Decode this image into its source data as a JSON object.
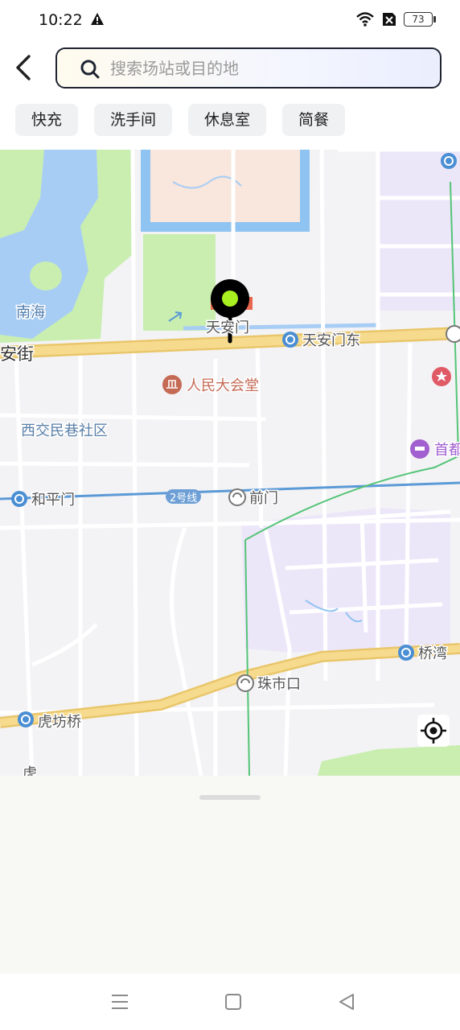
{
  "status_bar": {
    "time": "10:22",
    "battery": "73",
    "icons": [
      "warning-icon",
      "wifi-icon",
      "no-sim-icon",
      "battery-icon"
    ]
  },
  "header": {
    "back_icon": "chevron-left-icon",
    "search": {
      "placeholder": "搜索场站或目的地",
      "value": ""
    }
  },
  "filters": {
    "chips": [
      "快充",
      "洗手间",
      "休息室",
      "简餐"
    ]
  },
  "map": {
    "labels": {
      "nanhai": "南海",
      "an_jie": "安街",
      "tiananmen": "天安门",
      "tiananmen_east": "天安门东",
      "great_hall": "人民大会堂",
      "xijiao": "西交民巷社区",
      "heping_men": "和平门",
      "line2": "2号线",
      "qianmen": "前门",
      "shoudu": "首都",
      "qiaowan": "桥湾",
      "zhushikou": "珠市口",
      "hufangqiao": "虎坊桥",
      "hu": "虎"
    },
    "colors": {
      "water": "#a8cdf5",
      "park": "#c9eeb0",
      "palace": "#f9e6dc",
      "road_major": "#f6db8f",
      "purple_area": "#ece6f9",
      "subway": "#5b9ad6",
      "marker": "#000000",
      "marker_dot": "#a8f020"
    },
    "marker_icon": "map-pin-icon",
    "locate_icon": "crosshair-icon"
  },
  "bottom_nav": {
    "icons": [
      "menu-icon",
      "home-square-icon",
      "back-triangle-icon"
    ]
  }
}
